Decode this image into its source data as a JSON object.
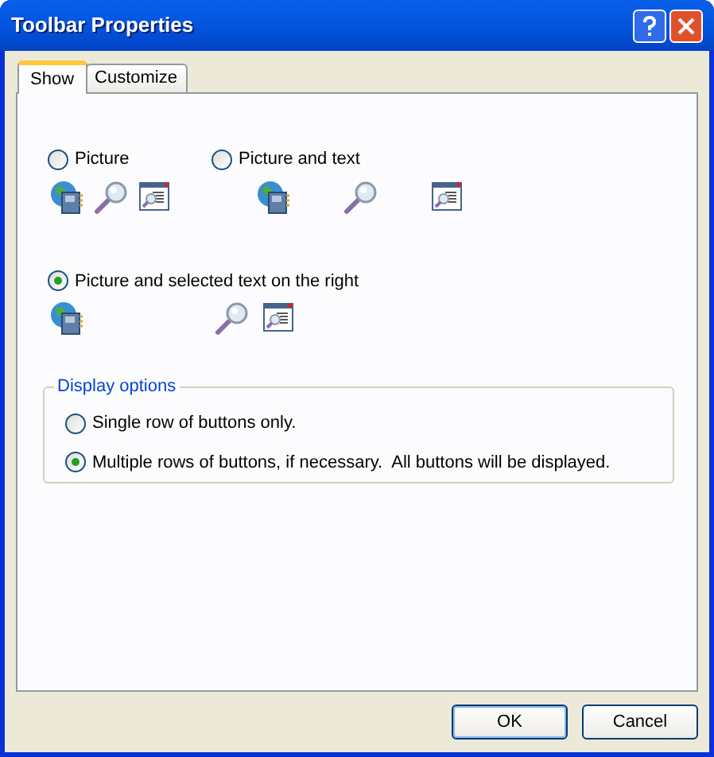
{
  "window": {
    "title": "Toolbar Properties"
  },
  "tabs": [
    {
      "label": "Show",
      "selected": true
    },
    {
      "label": "Customize",
      "selected": false
    }
  ],
  "text_options": [
    {
      "label": "Picture",
      "selected": false,
      "kind": "compact"
    },
    {
      "label": "Picture and text",
      "selected": false,
      "kind": "spread"
    },
    {
      "label": "Picture and selected text on the right",
      "selected": true,
      "kind": "right"
    }
  ],
  "display_options": {
    "title": "Display options",
    "options": [
      {
        "label": "Single row of buttons only.",
        "selected": false
      },
      {
        "label": "Multiple rows of buttons, if necessary.  All buttons will be displayed.",
        "selected": true
      }
    ]
  },
  "buttons": [
    {
      "label": "OK",
      "kind": "default"
    },
    {
      "label": "Cancel",
      "kind": "normal"
    }
  ]
}
